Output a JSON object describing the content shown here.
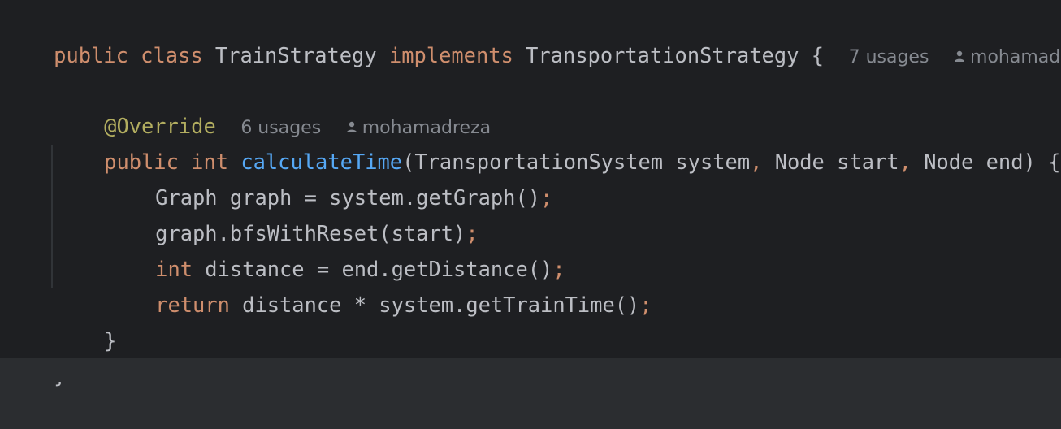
{
  "code": {
    "class_line": {
      "kw_public": "public",
      "kw_class": "class",
      "class_name": "TrainStrategy",
      "kw_implements": "implements",
      "interface_name": "TransportationStrategy",
      "brace": "{",
      "usages": "7 usages",
      "author": "mohamadreza"
    },
    "annotation_line": {
      "annotation": "@Override",
      "usages": "6 usages",
      "author": "mohamadreza"
    },
    "method_line": {
      "kw_public": "public",
      "kw_int": "int",
      "method_name": "calculateTime",
      "open_paren": "(",
      "param1_type": "TransportationSystem",
      "param1_name": "system",
      "comma1": ",",
      "param2_type": "Node",
      "param2_name": "start",
      "comma2": ",",
      "param3_type": "Node",
      "param3_name": "end",
      "close": ") {"
    },
    "body": [
      {
        "text": "Graph graph = system.getGraph()",
        "semi": ";"
      },
      {
        "text": "graph.bfsWithReset(start)",
        "semi": ";"
      },
      {
        "kw": "int",
        "text": " distance = end.getDistance()",
        "semi": ";"
      },
      {
        "kw": "return",
        "text": " distance * system.getTrainTime()",
        "semi": ";"
      }
    ],
    "method_close": "}",
    "class_close": "}"
  },
  "colors": {
    "background": "#1E1F22",
    "keyword": "#CF8E6D",
    "method": "#56A8F5",
    "annotation": "#B3AE60",
    "text": "#BCBEC4",
    "hint": "#868A91"
  }
}
